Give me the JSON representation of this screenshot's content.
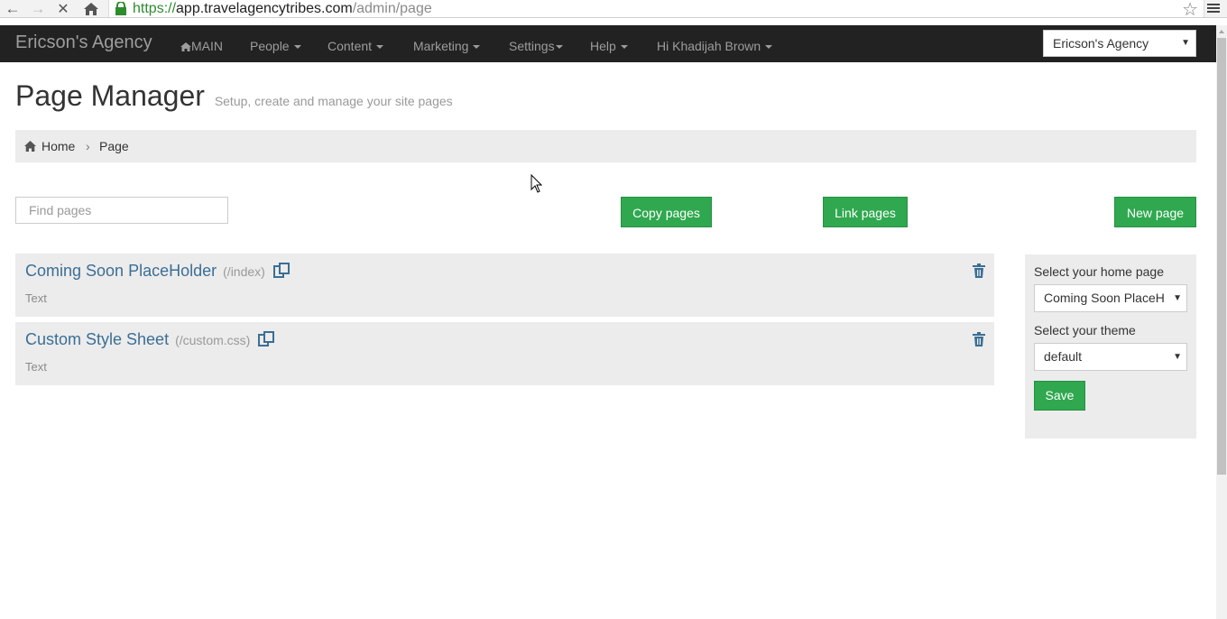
{
  "browser": {
    "url_scheme": "https://",
    "url_host": "app.travelagencytribes.com",
    "url_path": "/admin/page"
  },
  "navbar": {
    "brand": "Ericson's Agency",
    "items": [
      {
        "label": "MAIN",
        "icon": "home-icon"
      },
      {
        "label": "People"
      },
      {
        "label": "Content"
      },
      {
        "label": "Marketing"
      },
      {
        "label": "Settings"
      },
      {
        "label": "Help"
      },
      {
        "label": "Hi Khadijah Brown"
      }
    ],
    "agency_select": "Ericson's Agency"
  },
  "header": {
    "title": "Page Manager",
    "subtitle": "Setup, create and manage your site pages"
  },
  "breadcrumb": {
    "home": "Home",
    "current": "Page"
  },
  "toolbar": {
    "search_placeholder": "Find pages",
    "copy_label": "Copy pages",
    "link_label": "Link pages",
    "new_label": "New page"
  },
  "pages": [
    {
      "title": "Coming Soon PlaceHolder",
      "path": "(/index)",
      "type": "Text"
    },
    {
      "title": "Custom Style Sheet",
      "path": "(/custom.css)",
      "type": "Text"
    }
  ],
  "side_panel": {
    "home_label": "Select your home page",
    "home_value": "Coming Soon PlaceH",
    "theme_label": "Select your theme",
    "theme_value": "default",
    "save_label": "Save"
  },
  "colors": {
    "navbar": "#222222",
    "accent_green": "#2fa84f",
    "link_blue": "#3b6e96",
    "panel_gray": "#ececec"
  }
}
